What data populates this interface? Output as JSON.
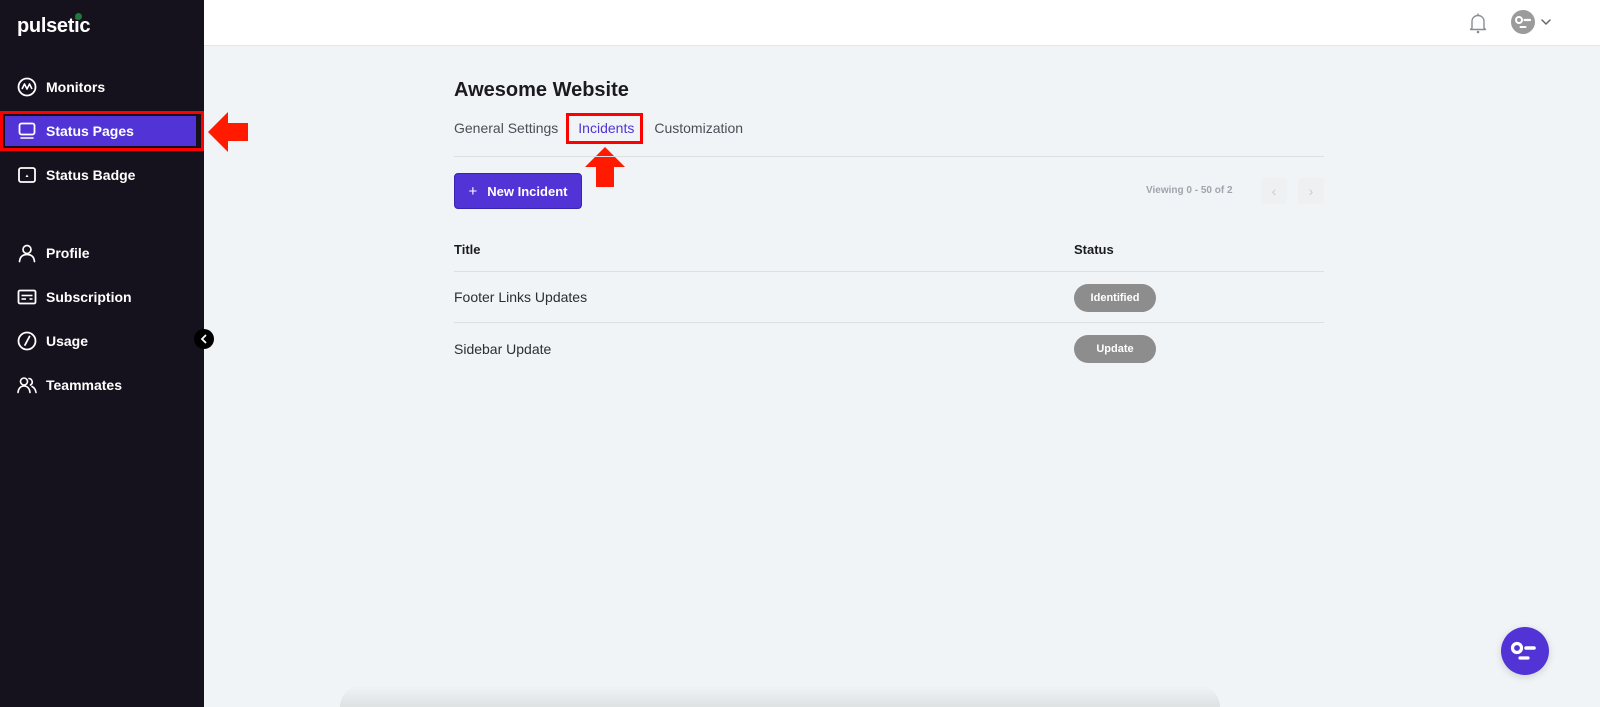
{
  "brand": {
    "name": "pulsetic"
  },
  "sidebar": {
    "items": [
      {
        "label": "Monitors",
        "icon": "monitors-icon"
      },
      {
        "label": "Status Pages",
        "icon": "status-pages-icon",
        "active": true
      },
      {
        "label": "Status Badge",
        "icon": "status-badge-icon"
      },
      {
        "label": "Profile",
        "icon": "profile-icon"
      },
      {
        "label": "Subscription",
        "icon": "subscription-icon"
      },
      {
        "label": "Usage",
        "icon": "usage-icon"
      },
      {
        "label": "Teammates",
        "icon": "teammates-icon"
      }
    ],
    "collapse_icon": "chevron-left-icon"
  },
  "topbar": {
    "notification_icon": "bell-icon",
    "avatar_icon": "avatar-icon",
    "menu_icon": "chevron-down-icon"
  },
  "page": {
    "title": "Awesome Website",
    "tabs": [
      {
        "label": "General Settings"
      },
      {
        "label": "Incidents",
        "active": true
      },
      {
        "label": "Customization"
      }
    ]
  },
  "toolbar": {
    "new_incident_label": "New Incident",
    "new_incident_icon": "+",
    "pagination_text": "Viewing 0 - 50 of 2",
    "prev_icon": "‹",
    "next_icon": "›"
  },
  "table": {
    "columns": [
      "Title",
      "Status"
    ],
    "rows": [
      {
        "title": "Footer Links Updates",
        "status": "Identified"
      },
      {
        "title": "Sidebar Update",
        "status": "Update"
      }
    ]
  },
  "colors": {
    "accent": "#5133d6",
    "sidebar_bg": "#15121d",
    "badge_bg": "#8c8d8c",
    "annotation": "#ff0000"
  }
}
